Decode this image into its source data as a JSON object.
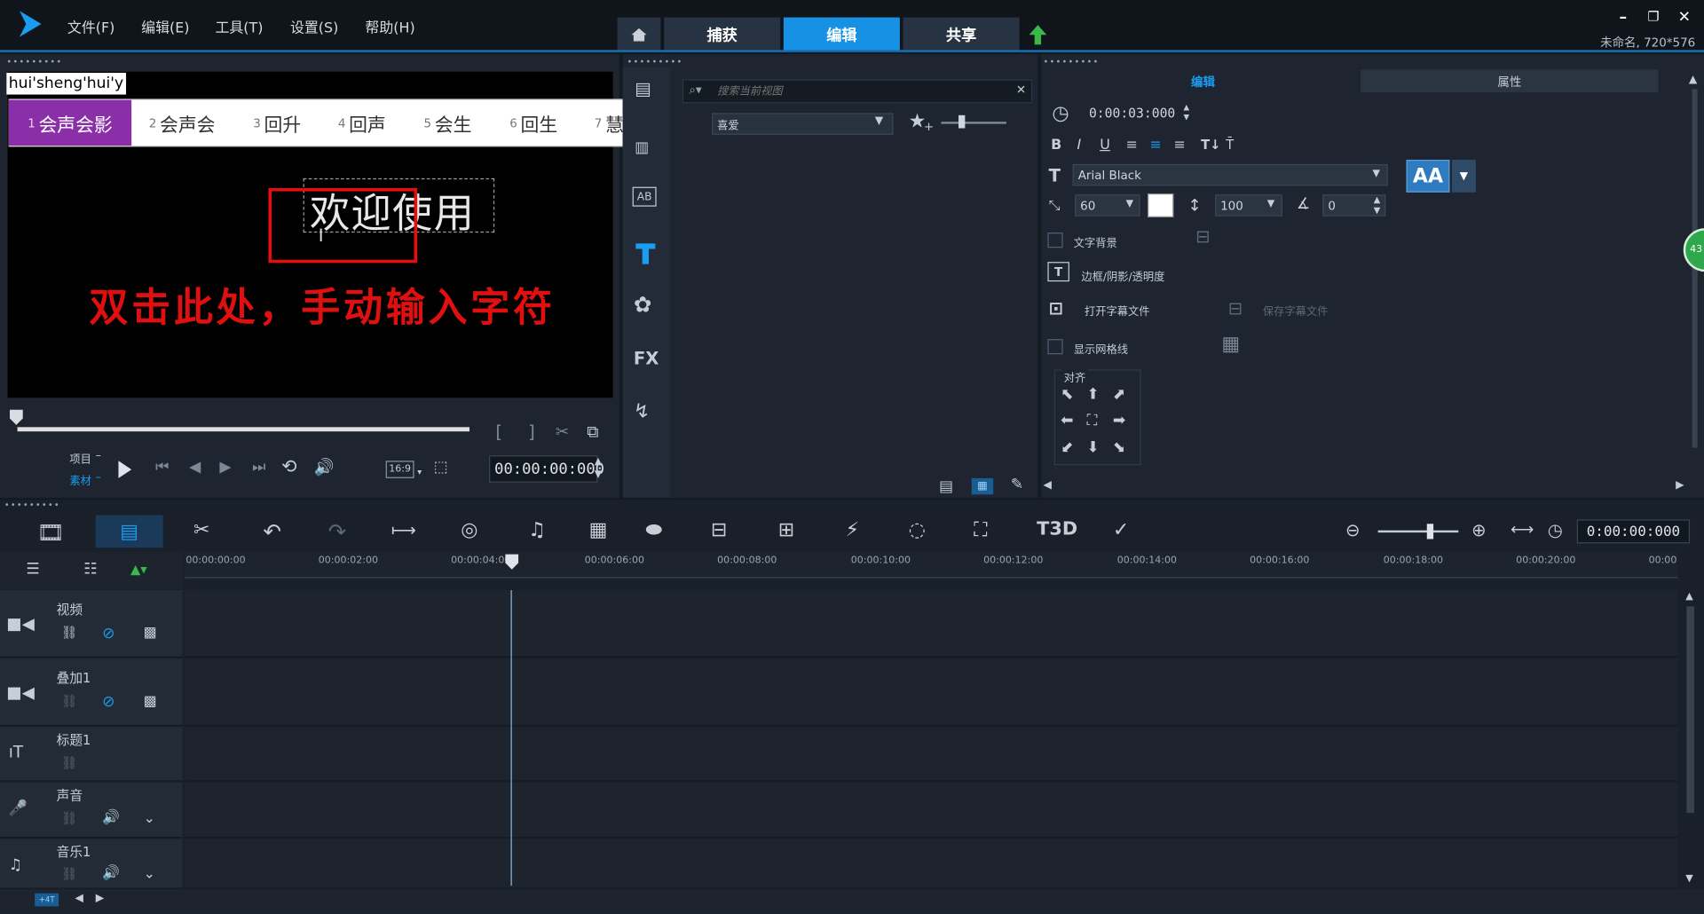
{
  "menu": {
    "items": [
      "文件(F)",
      "编辑(E)",
      "工具(T)",
      "设置(S)",
      "帮助(H)"
    ]
  },
  "nav_tabs": [
    "捕获",
    "编辑",
    "共享"
  ],
  "project_info": "未命名, 720*576",
  "ime": {
    "composition": "hui'sheng'hui'y",
    "candidates": [
      {
        "num": "1",
        "text": "会声会影"
      },
      {
        "num": "2",
        "text": "会声会"
      },
      {
        "num": "3",
        "text": "回升"
      },
      {
        "num": "4",
        "text": "回声"
      },
      {
        "num": "5",
        "text": "会生"
      },
      {
        "num": "6",
        "text": "回生"
      },
      {
        "num": "7",
        "text": "慧生"
      }
    ],
    "emoji_symbol": "☺"
  },
  "preview": {
    "title_text": "欢迎使用",
    "annotation": "双击此处，手动输入字符",
    "project_label": "项目",
    "clip_label": "素材",
    "aspect": "16:9",
    "timecode": "00:00:00:000"
  },
  "library": {
    "search_placeholder": "搜索当前视图",
    "dropdown_value": "喜爱"
  },
  "options": {
    "tab_edit": "编辑",
    "tab_attr": "属性",
    "duration": "0:00:03:000",
    "font_name": "Arial Black",
    "font_size": "60",
    "line_spacing": "100",
    "angle": "0",
    "text_bg_label": "文字背景",
    "border_label": "边框/阴影/透明度",
    "open_subtitle": "打开字幕文件",
    "save_subtitle": "保存字幕文件",
    "show_grid": "显示网格线",
    "align_label": "对齐",
    "aa_label": "AA",
    "green_badge": "43"
  },
  "timeline": {
    "timecode": "0:00:00:000",
    "ruler": [
      "00:00:00:00",
      "00:00:02:00",
      "00:00:04:00",
      "00:00:06:00",
      "00:00:08:00",
      "00:00:10:00",
      "00:00:12:00",
      "00:00:14:00",
      "00:00:16:00",
      "00:00:18:00",
      "00:00:20:00",
      "00:00"
    ],
    "tracks": [
      "视频",
      "叠加1",
      "标题1",
      "声音",
      "音乐1"
    ]
  },
  "colors": {
    "accent": "#1691e3",
    "ime_selected": "#8b2fa8",
    "annotation_red": "#e01010"
  }
}
